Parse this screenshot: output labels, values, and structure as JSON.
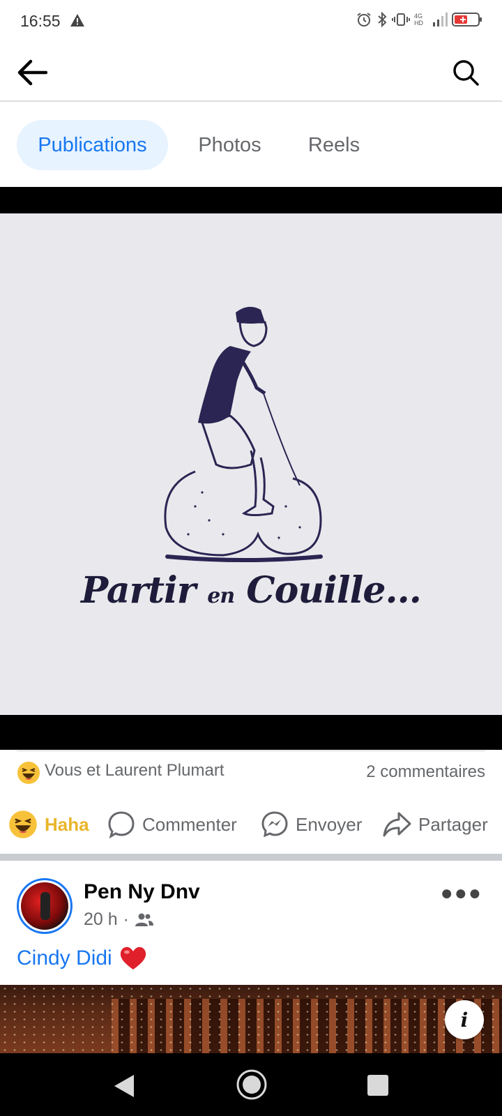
{
  "status_bar": {
    "time": "16:55",
    "network": "4G HD"
  },
  "app_bar": {
    "back_icon": "arrow-left-icon",
    "search_icon": "search-icon"
  },
  "tabs": [
    {
      "label": "Publications",
      "active": true
    },
    {
      "label": "Photos",
      "active": false
    },
    {
      "label": "Reels",
      "active": false
    }
  ],
  "post": {
    "image_caption_main1": "Partir",
    "image_caption_small": "en",
    "image_caption_main2": "Couille...",
    "reactions_text": "Vous et Laurent Plumart",
    "comments_text": "2 commentaires",
    "actions": {
      "haha": "Haha",
      "comment": "Commenter",
      "send": "Envoyer",
      "share": "Partager"
    }
  },
  "post2": {
    "author": "Pen Ny Dnv",
    "time": "20 h",
    "separator": "·",
    "text": "Cindy Didi"
  },
  "colors": {
    "accent": "#1877f2",
    "haha": "#e9b52a",
    "secondary_text": "#65676b"
  }
}
